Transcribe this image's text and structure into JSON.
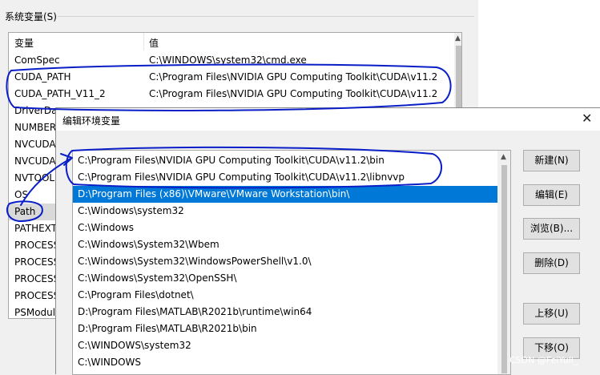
{
  "group_label": "系统变量(S)",
  "system_vars": {
    "headers": {
      "name": "变量",
      "value": "值"
    },
    "rows": [
      {
        "name": "ComSpec",
        "value": "C:\\WINDOWS\\system32\\cmd.exe"
      },
      {
        "name": "CUDA_PATH",
        "value": "C:\\Program Files\\NVIDIA GPU Computing Toolkit\\CUDA\\v11.2"
      },
      {
        "name": "CUDA_PATH_V11_2",
        "value": "C:\\Program Files\\NVIDIA GPU Computing Toolkit\\CUDA\\v11.2"
      },
      {
        "name": "DriverDa",
        "value": ""
      },
      {
        "name": "NUMBER",
        "value": ""
      },
      {
        "name": "NVCUDA",
        "value": ""
      },
      {
        "name": "NVCUDA",
        "value": ""
      },
      {
        "name": "NVTOOL",
        "value": ""
      },
      {
        "name": "OS",
        "value": ""
      },
      {
        "name": "Path",
        "value": ""
      },
      {
        "name": "PATHEXT",
        "value": ""
      },
      {
        "name": "PROCESS",
        "value": ""
      },
      {
        "name": "PROCESS",
        "value": ""
      },
      {
        "name": "PROCESS",
        "value": ""
      },
      {
        "name": "PROCESS",
        "value": ""
      },
      {
        "name": "PSModul",
        "value": ""
      }
    ],
    "selected_index": 9
  },
  "dialog": {
    "title": "编辑环境变量",
    "close_glyph": "✕",
    "paths": [
      "C:\\Program Files\\NVIDIA GPU Computing Toolkit\\CUDA\\v11.2\\bin",
      "C:\\Program Files\\NVIDIA GPU Computing Toolkit\\CUDA\\v11.2\\libnvvp",
      "D:\\Program Files (x86)\\VMware\\VMware Workstation\\bin\\",
      "C:\\Windows\\system32",
      "C:\\Windows",
      "C:\\Windows\\System32\\Wbem",
      "C:\\Windows\\System32\\WindowsPowerShell\\v1.0\\",
      "C:\\Windows\\System32\\OpenSSH\\",
      "C:\\Program Files\\dotnet\\",
      "D:\\Program Files\\MATLAB\\R2021b\\runtime\\win64",
      "D:\\Program Files\\MATLAB\\R2021b\\bin",
      "C:\\WINDOWS\\system32",
      "C:\\WINDOWS"
    ],
    "selected_index": 2,
    "buttons": {
      "new": "新建(N)",
      "edit": "编辑(E)",
      "browse": "浏览(B)...",
      "delete": "删除(D)",
      "move_up": "上移(U)",
      "move_down": "下移(O)"
    }
  },
  "watermark": "CSDN @FeiYull_",
  "colors": {
    "selection_blue": "#0078d7",
    "annotation_ink": "#0a1ec8",
    "button_face": "#e1e1e1"
  }
}
